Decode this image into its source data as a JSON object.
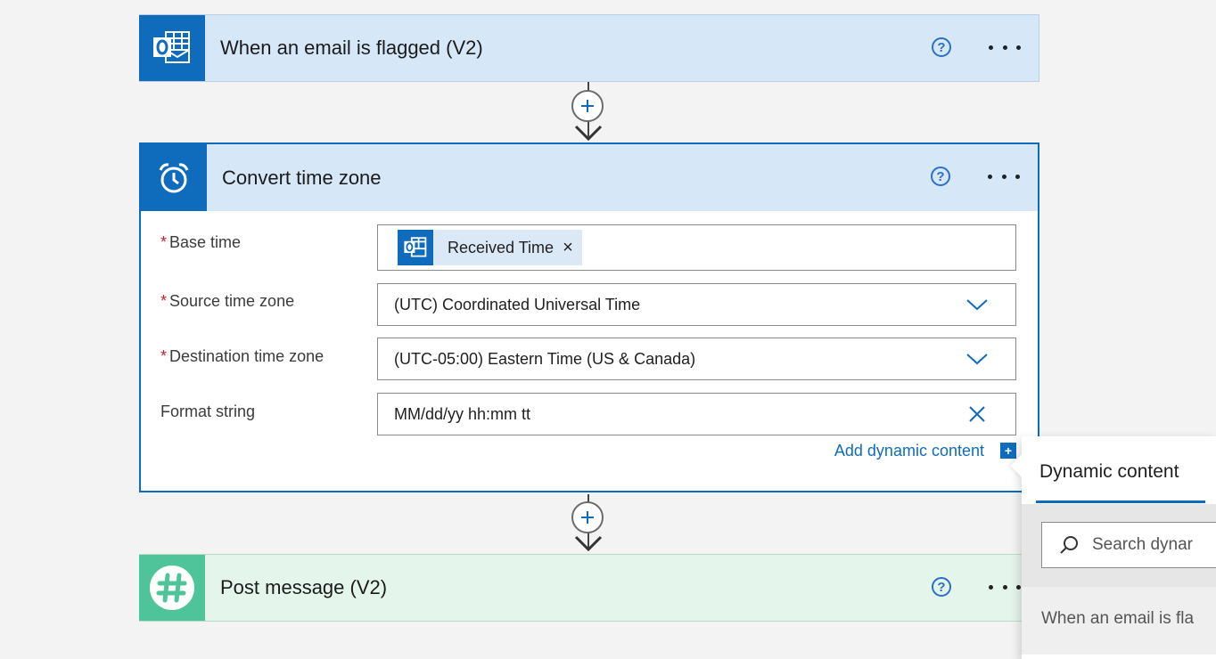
{
  "trigger": {
    "title": "When an email is flagged (V2)",
    "help": "?",
    "icon": "outlook-icon"
  },
  "action": {
    "title": "Convert time zone",
    "help": "?",
    "icon": "alarm-clock-icon",
    "fields": {
      "base_time": {
        "label": "Base time",
        "required": "*",
        "token": "Received Time",
        "token_remove": "×"
      },
      "source_tz": {
        "label": "Source time zone",
        "required": "*",
        "value": "(UTC) Coordinated Universal Time"
      },
      "dest_tz": {
        "label": "Destination time zone",
        "required": "*",
        "value": "(UTC-05:00) Eastern Time (US & Canada)"
      },
      "format": {
        "label": "Format string",
        "value": "MM/dd/yy hh:mm tt"
      }
    },
    "add_dynamic": "Add dynamic content",
    "add_dynamic_icon": "+"
  },
  "slack": {
    "title": "Post message (V2)",
    "help": "?",
    "icon": "slack-hash-icon"
  },
  "dynamic_panel": {
    "title": "Dynamic content",
    "search_placeholder": "Search dynar",
    "group_label": "When an email is fla"
  },
  "colors": {
    "accent": "#0f6cbd",
    "header_bg": "#d6e7f8",
    "slack_bg": "#e4f5ec",
    "slack_icon": "#4fc49a",
    "required": "#c4262e"
  }
}
